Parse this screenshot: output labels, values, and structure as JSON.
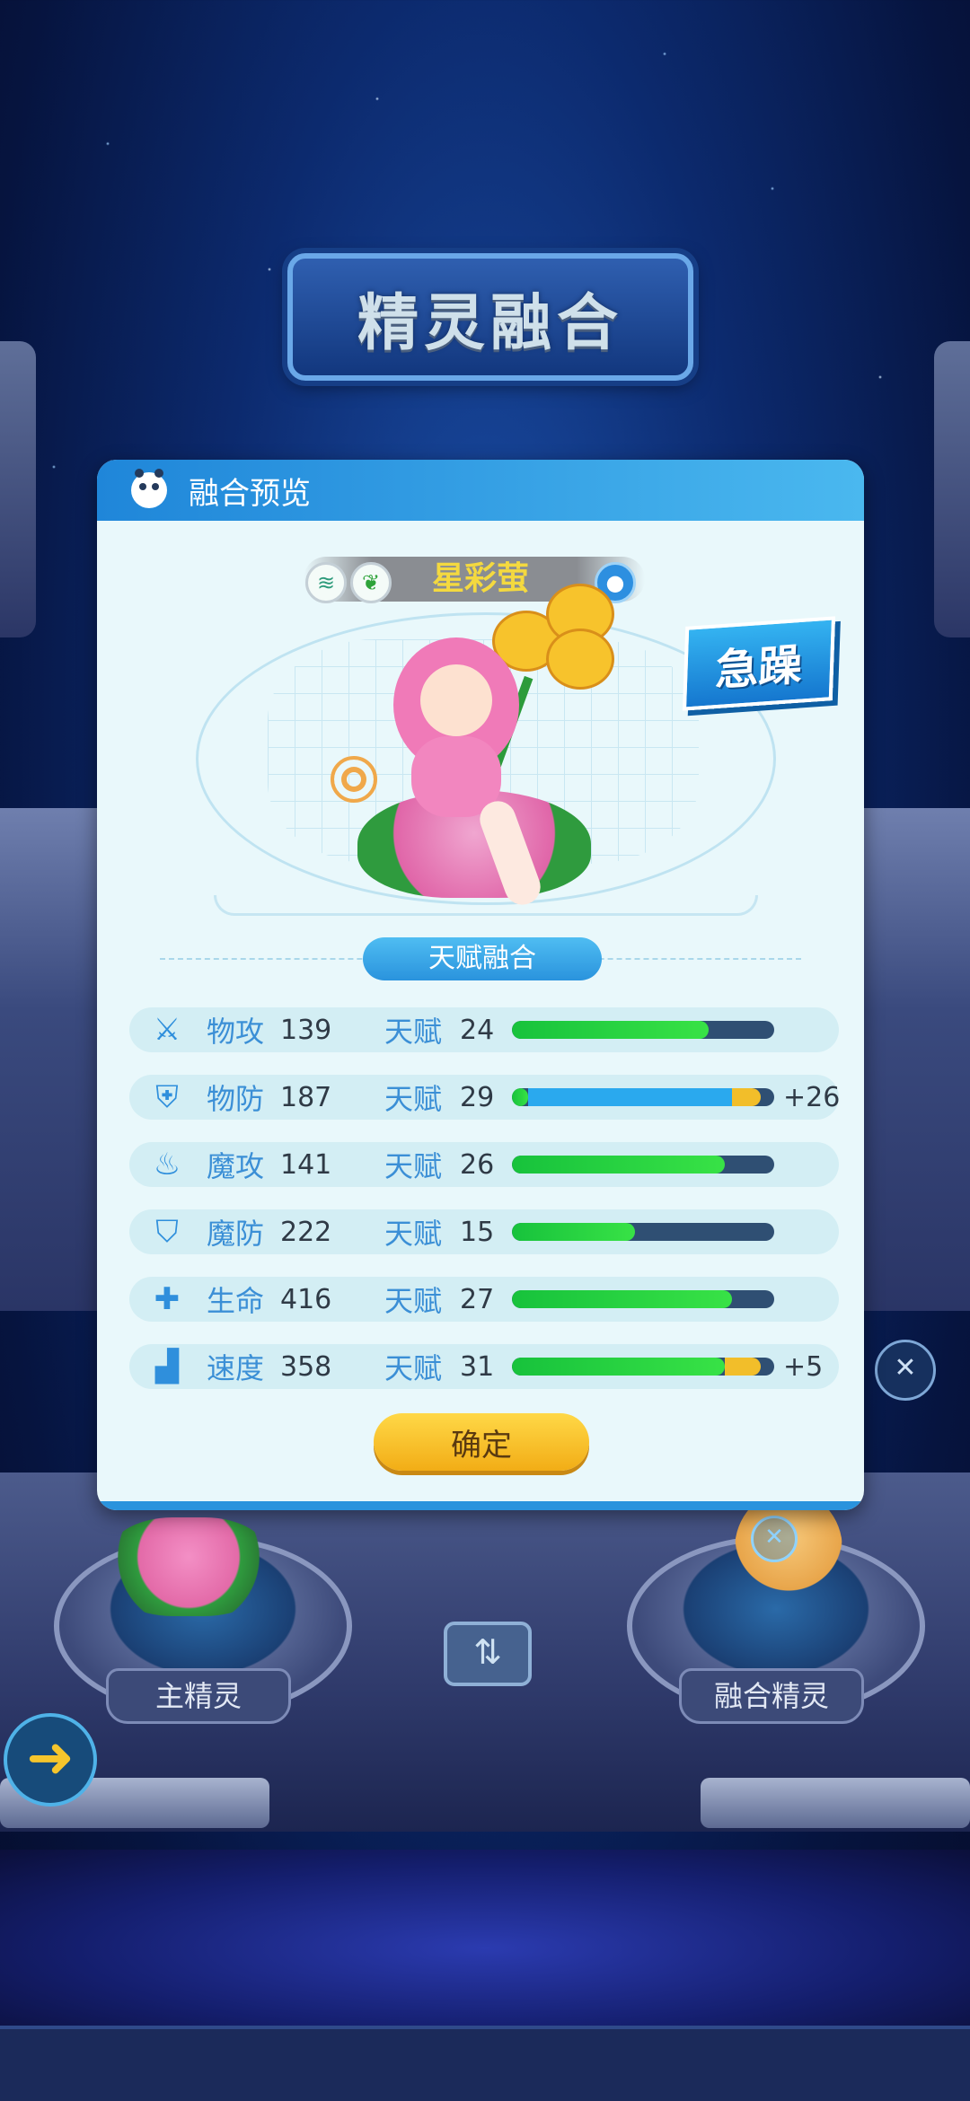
{
  "screen_title": "精灵融合",
  "panel": {
    "title": "融合预览",
    "pet_name": "星彩萤",
    "trait": "急躁",
    "section_title": "天赋融合",
    "confirm_label": "确定"
  },
  "stats": [
    {
      "name": "物攻",
      "value": "139",
      "talent_label": "天赋",
      "talent": "24",
      "talent_fraction": 0.75,
      "bonus": ""
    },
    {
      "name": "物防",
      "value": "187",
      "talent_label": "天赋",
      "talent": "29",
      "talent_fraction": 0.06,
      "bonus": "+26"
    },
    {
      "name": "魔攻",
      "value": "141",
      "talent_label": "天赋",
      "talent": "26",
      "talent_fraction": 0.81,
      "bonus": ""
    },
    {
      "name": "魔防",
      "value": "222",
      "talent_label": "天赋",
      "talent": "15",
      "talent_fraction": 0.47,
      "bonus": ""
    },
    {
      "name": "生命",
      "value": "416",
      "talent_label": "天赋",
      "talent": "27",
      "talent_fraction": 0.84,
      "bonus": ""
    },
    {
      "name": "速度",
      "value": "358",
      "talent_label": "天赋",
      "talent": "31",
      "talent_fraction": 0.81,
      "bonus": "+5"
    }
  ],
  "slots": {
    "main_label": "主精灵",
    "fusion_label": "融合精灵"
  },
  "icons": {
    "stat_icons": [
      "sword-icon",
      "shield-icon",
      "flame-icon",
      "magic-shield-icon",
      "heart-plus-icon",
      "boot-icon"
    ],
    "element_icons": [
      "wind-icon",
      "grass-icon",
      "panda-icon"
    ]
  },
  "colors": {
    "accent_blue": "#2a93dd",
    "talent_bar_green": "#17c23c",
    "bonus_bar_gold": "#f2be2a",
    "confirm_yellow": "#ffd847",
    "pet_name_yellow": "#f4d93f"
  }
}
